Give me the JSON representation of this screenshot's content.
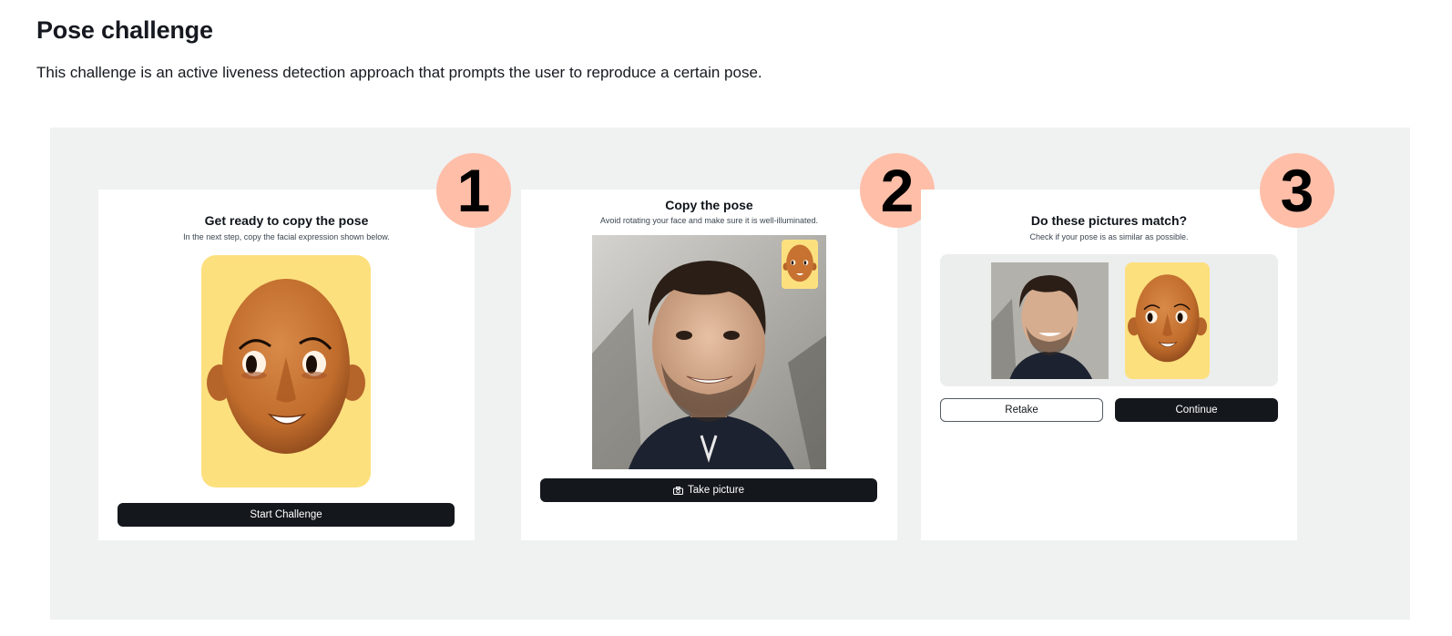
{
  "page": {
    "title": "Pose challenge",
    "description": "This challenge is an active liveness detection approach that prompts the user to reproduce a certain pose."
  },
  "steps": [
    {
      "badge": "1",
      "title": "Get ready to copy the pose",
      "subtitle": "In the next step, copy the facial expression shown below.",
      "button_label": "Start Challenge"
    },
    {
      "badge": "2",
      "title": "Copy the pose",
      "subtitle": "Avoid rotating your face and make sure it is well-illuminated.",
      "button_label": "Take picture",
      "button_icon": "camera-icon"
    },
    {
      "badge": "3",
      "title": "Do these pictures match?",
      "subtitle": "Check if your pose is as similar as possible.",
      "retake_label": "Retake",
      "continue_label": "Continue"
    }
  ],
  "colors": {
    "badge": "#ffbea8",
    "stage_background": "#f0f1f1",
    "avatar_background": "#fde07e",
    "button_dark": "#14181d"
  }
}
